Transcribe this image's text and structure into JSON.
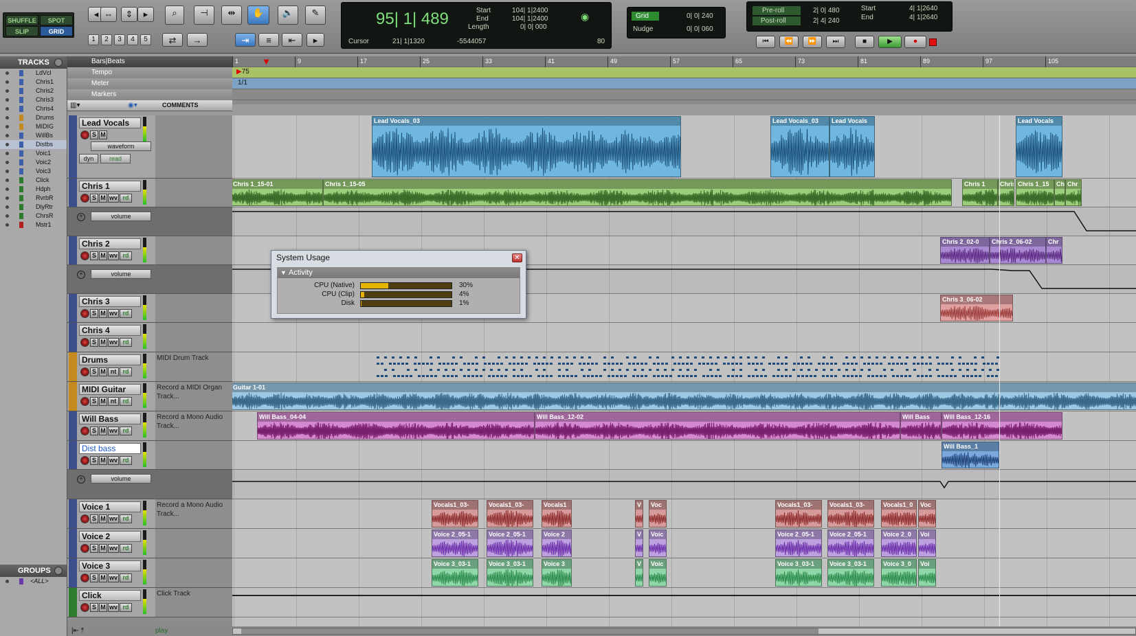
{
  "toolbar": {
    "modes": [
      "SHUFFLE",
      "SPOT",
      "SLIP",
      "GRID"
    ],
    "num_buttons": [
      "1",
      "2",
      "3",
      "4",
      "5"
    ],
    "counter": {
      "main": "95| 1| 489",
      "start_label": "Start",
      "end_label": "End",
      "length_label": "Length",
      "start": "104| 1|2400",
      "end": "104| 1|2400",
      "length": "0| 0| 000",
      "cursor_label": "Cursor",
      "cursor": "21| 1|1320",
      "cursor_val": "-5544057",
      "tempo": "80"
    },
    "grid": {
      "label": "Grid",
      "value": "0| 0| 240",
      "nudge_label": "Nudge",
      "nudge_value": "0| 0| 060"
    },
    "preroll": {
      "pre_label": "Pre-roll",
      "pre": "2| 0| 480",
      "post_label": "Post-roll",
      "post": "2| 4| 240",
      "start_label": "Start",
      "start": "4| 1|2640",
      "end_label": "End",
      "end": "4| 1|2640"
    }
  },
  "tracks_panel": {
    "title": "TRACKS",
    "items": [
      "LdVcl",
      "Chris1",
      "Chris2",
      "Chris3",
      "Chris4",
      "Drums",
      "MIDIG",
      "WillBs",
      "Distbs",
      "Voic1",
      "Voic2",
      "Voic3",
      "Click",
      "Hdph",
      "RvrbR",
      "DlyRtr",
      "ChrsR",
      "Mstr1"
    ]
  },
  "groups_panel": {
    "title": "GROUPS",
    "all": "<ALL>"
  },
  "ruler": {
    "timebase": "Bars|Beats",
    "tempo": "Tempo",
    "tempo_value": "75",
    "meter": "Meter",
    "meter_value": "1/1",
    "markers": "Markers",
    "comments": "COMMENTS",
    "bars": [
      "1",
      "9",
      "17",
      "25",
      "33",
      "41",
      "49",
      "57",
      "65",
      "73",
      "81",
      "89",
      "97",
      "105"
    ]
  },
  "tracks": [
    {
      "name": "Lead Vocals",
      "comment": "",
      "view": "waveform",
      "extra": "dyn",
      "auto": "read"
    },
    {
      "name": "Chris 1",
      "comment": "",
      "auto_lane": "volume"
    },
    {
      "name": "Chris 2",
      "comment": "",
      "auto_lane": "volume"
    },
    {
      "name": "Chris 3",
      "comment": ""
    },
    {
      "name": "Chris 4",
      "comment": ""
    },
    {
      "name": "Drums",
      "comment": "MIDI Drum Track"
    },
    {
      "name": "MIDI Guitar",
      "comment": "Record a MIDI Organ Track..."
    },
    {
      "name": "Will Bass",
      "comment": "Record a Mono Audio Track..."
    },
    {
      "name": "Dist bass",
      "comment": "",
      "auto_lane": "volume"
    },
    {
      "name": "Voice 1",
      "comment": "Record a Mono Audio Track..."
    },
    {
      "name": "Voice 2",
      "comment": ""
    },
    {
      "name": "Voice 3",
      "comment": ""
    },
    {
      "name": "Click",
      "comment": "Click Track"
    }
  ],
  "clips": {
    "lead": [
      "Lead Vocals_03",
      "Lead Vocals_03",
      "Lead Vocals",
      "Lead Vocals"
    ],
    "chris1": [
      "Chris 1_15-01",
      "Chris 1_15-05",
      "Chris 1",
      "Chris",
      "Chris 1_15",
      "Ch",
      "Chr"
    ],
    "chris2": [
      "Chris 2_02-0",
      "Chris 2_06-02",
      "Chr"
    ],
    "chris3": [
      "Chris 3_06-02"
    ],
    "guitar": [
      "Guitar 1-01"
    ],
    "willbass": [
      "Will Bass_04-04",
      "Will Bass_12-02",
      "Will Bass",
      "Will Bass_12-16"
    ],
    "distbass": [
      "Will Bass_1"
    ],
    "voice1": [
      "Vocals1_03-",
      "Vocals1_03-",
      "Vocals1",
      "V",
      "Voc",
      "Vocals1_03-",
      "Vocals1_03-",
      "Vocals1_0",
      "Voc"
    ],
    "voice2": [
      "Voice 2_05-1",
      "Voice 2_05-1",
      "Voice 2",
      "V",
      "Voic",
      "Voice 2_05-1",
      "Voice 2_05-1",
      "Voice 2_0",
      "Voi"
    ],
    "voice3": [
      "Voice 3_03-1",
      "Voice 3_03-1",
      "Voice 3",
      "V",
      "Voic",
      "Voice 3_03-1",
      "Voice 3_03-1",
      "Voice 3_0",
      "Voi"
    ]
  },
  "system_usage": {
    "title": "System Usage",
    "section": "Activity",
    "rows": [
      {
        "label": "CPU (Native)",
        "pct": 30,
        "text": "30%"
      },
      {
        "label": "CPU (Clip)",
        "pct": 4,
        "text": "4%"
      },
      {
        "label": "Disk",
        "pct": 1,
        "text": "1%"
      }
    ]
  },
  "footer": {
    "play": "play"
  },
  "colors": {
    "lead": "#1a4f78",
    "chris1": "#3a6d2a",
    "chris2": "#5a2880",
    "chris3": "#9a3a3a",
    "guitar": "#9cc8e4",
    "willbass": "#7a1e6e",
    "distbass": "#1e3e78",
    "voice1": "#8c2a2a",
    "voice2": "#6a2ca8",
    "voice3": "#2a8a4a"
  }
}
